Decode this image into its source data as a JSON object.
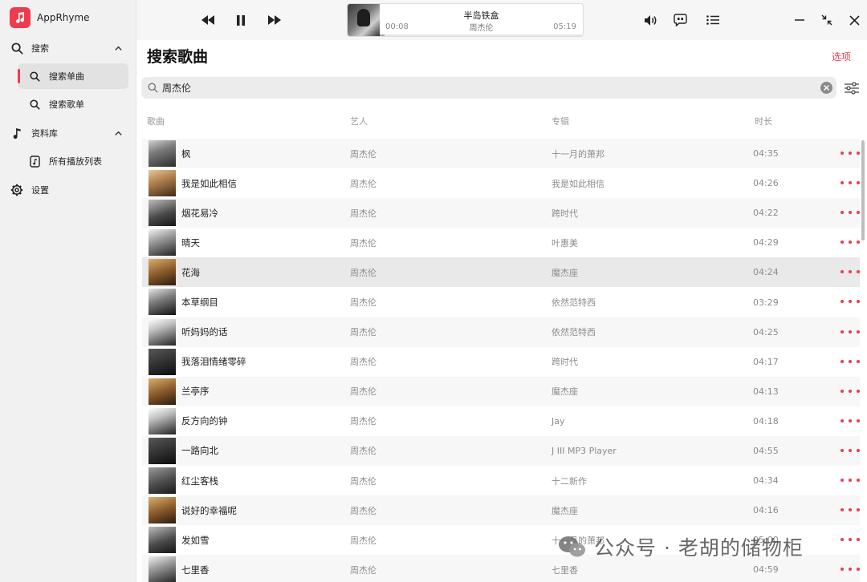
{
  "app": {
    "name": "AppRhyme"
  },
  "sidebar": {
    "items": [
      {
        "label": "搜索"
      },
      {
        "label": "搜索单曲"
      },
      {
        "label": "搜索歌单"
      },
      {
        "label": "资料库"
      },
      {
        "label": "所有播放列表"
      },
      {
        "label": "设置"
      }
    ]
  },
  "player": {
    "title": "半岛铁盒",
    "artist": "周杰伦",
    "current_time": "00:08",
    "duration": "05:19",
    "progress_fraction": 0.025
  },
  "main": {
    "title": "搜索歌曲",
    "options_label": "选项",
    "search": {
      "value": "周杰伦"
    },
    "columns": {
      "song": "歌曲",
      "artist": "艺人",
      "album": "专辑",
      "duration": "时长"
    },
    "rows": [
      {
        "title": "枫",
        "artist": "周杰伦",
        "album": "十一月的萧邦",
        "duration": "04:35"
      },
      {
        "title": "我是如此相信",
        "artist": "周杰伦",
        "album": "我是如此相信",
        "duration": "04:26"
      },
      {
        "title": "烟花易冷",
        "artist": "周杰伦",
        "album": "跨时代",
        "duration": "04:22"
      },
      {
        "title": "晴天",
        "artist": "周杰伦",
        "album": "叶惠美",
        "duration": "04:29"
      },
      {
        "title": "花海",
        "artist": "周杰伦",
        "album": "魔杰座",
        "duration": "04:24"
      },
      {
        "title": "本草纲目",
        "artist": "周杰伦",
        "album": "依然范特西",
        "duration": "03:29"
      },
      {
        "title": "听妈妈的话",
        "artist": "周杰伦",
        "album": "依然范特西",
        "duration": "04:25"
      },
      {
        "title": "我落泪情绪零碎",
        "artist": "周杰伦",
        "album": "跨时代",
        "duration": "04:17"
      },
      {
        "title": "兰亭序",
        "artist": "周杰伦",
        "album": "魔杰座",
        "duration": "04:13"
      },
      {
        "title": "反方向的钟",
        "artist": "周杰伦",
        "album": "Jay",
        "duration": "04:18"
      },
      {
        "title": "一路向北",
        "artist": "周杰伦",
        "album": "J III MP3 Player",
        "duration": "04:55"
      },
      {
        "title": "红尘客栈",
        "artist": "周杰伦",
        "album": "十二新作",
        "duration": "04:34"
      },
      {
        "title": "说好的幸福呢",
        "artist": "周杰伦",
        "album": "魔杰座",
        "duration": "04:16"
      },
      {
        "title": "发如雪",
        "artist": "周杰伦",
        "album": "十一月的萧邦",
        "duration": "05:00"
      },
      {
        "title": "七里香",
        "artist": "周杰伦",
        "album": "七里香",
        "duration": "04:59"
      }
    ]
  },
  "watermark": {
    "text": "公众号 · 老胡的储物柜"
  },
  "colors": {
    "accent": "#ef3b4c",
    "sidebar_bg": "#f1f1f1"
  }
}
